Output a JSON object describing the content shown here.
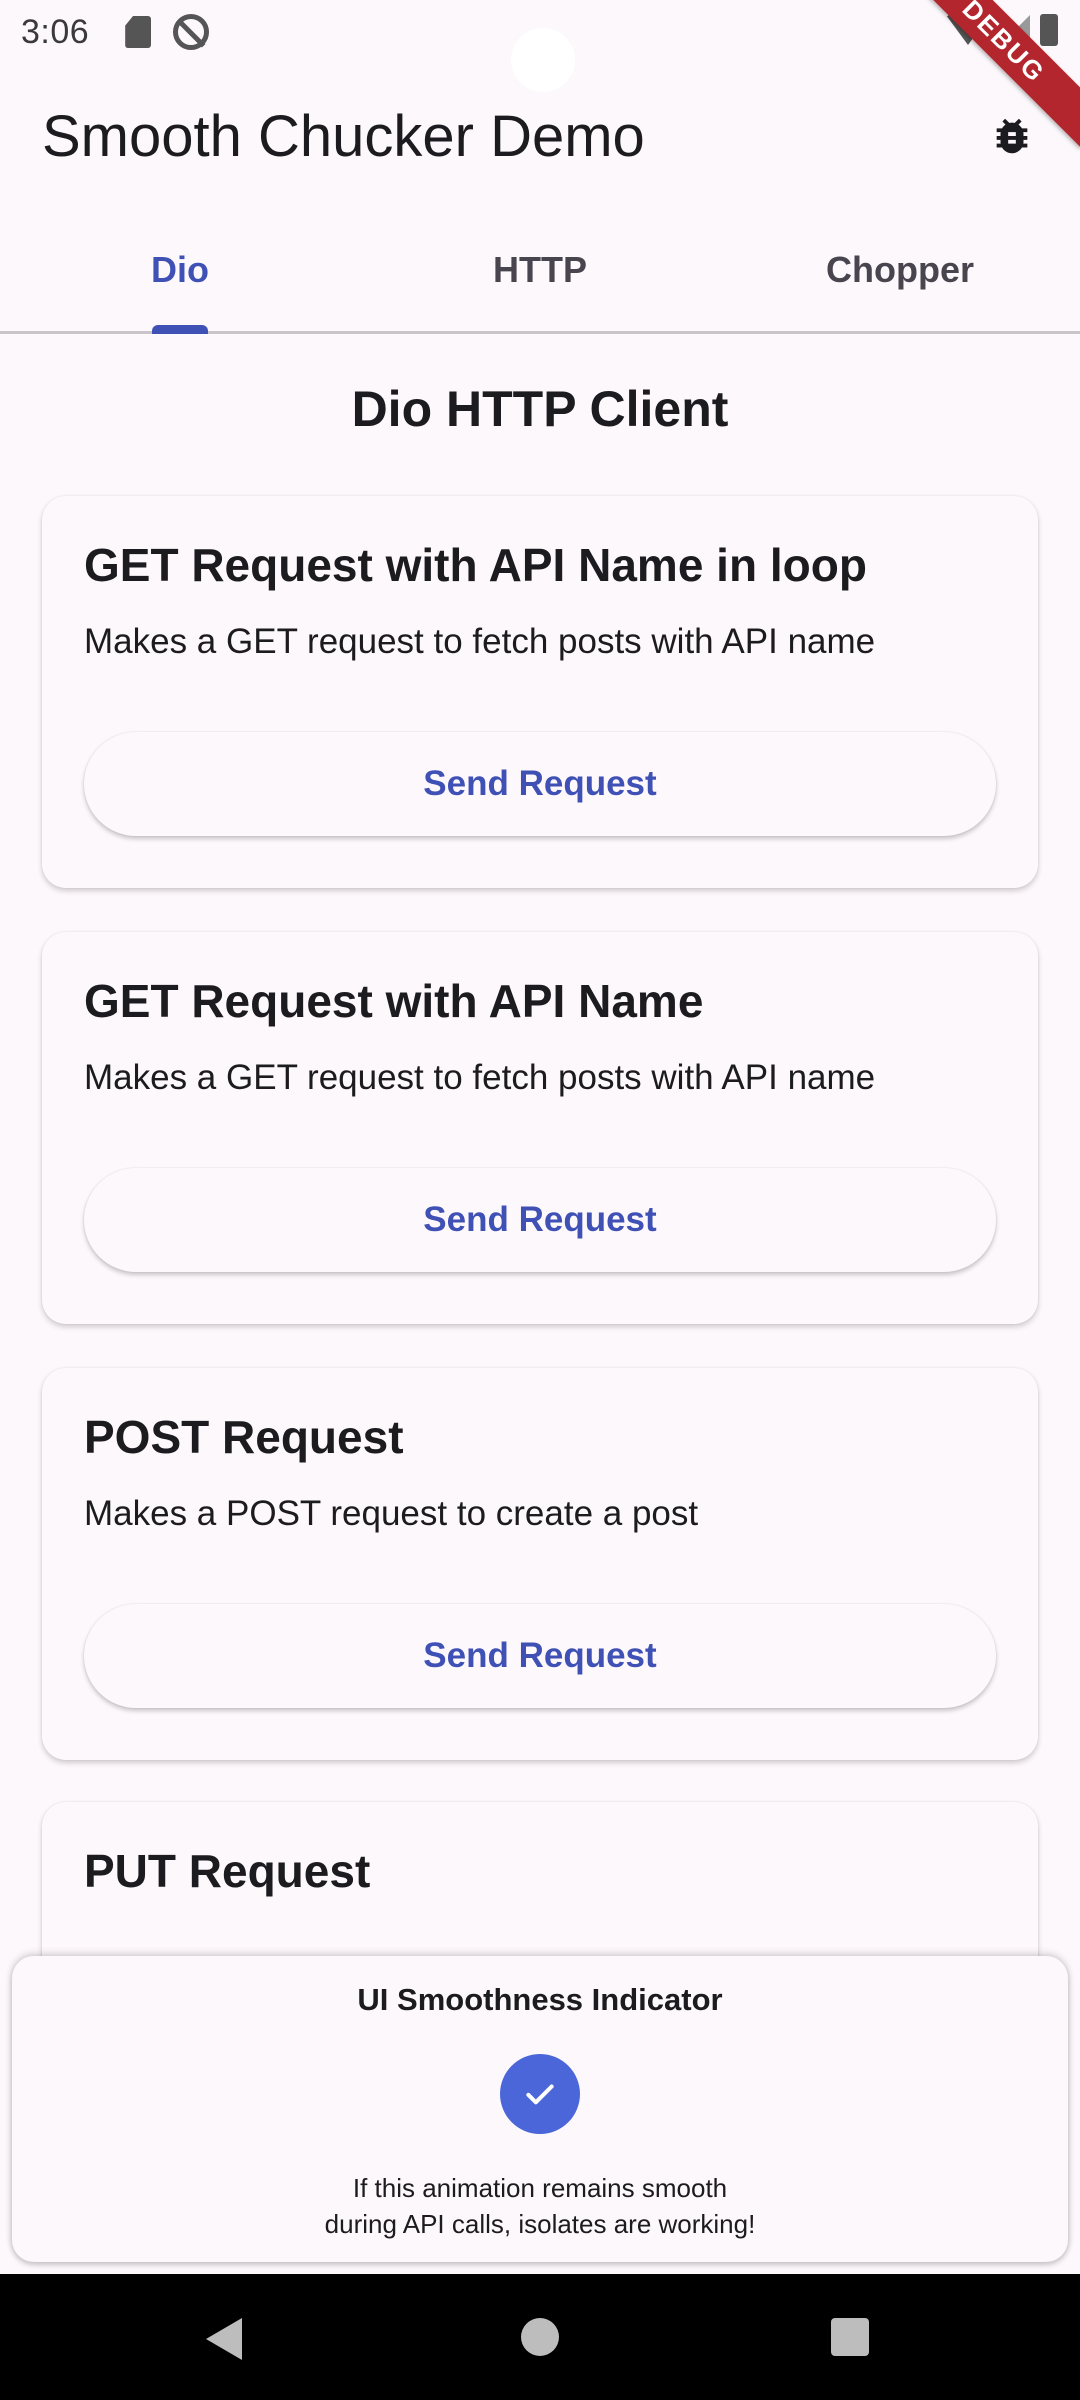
{
  "status_bar": {
    "time": "3:06",
    "debug_banner": "DEBUG"
  },
  "app_bar": {
    "title": "Smooth Chucker Demo",
    "action_icon": "bug-icon"
  },
  "tabs": [
    {
      "label": "Dio",
      "active": true
    },
    {
      "label": "HTTP",
      "active": false
    },
    {
      "label": "Chopper",
      "active": false
    }
  ],
  "page": {
    "heading": "Dio HTTP Client"
  },
  "cards": [
    {
      "title": "GET Request with API Name in loop",
      "description": "Makes a GET request to fetch posts with API name",
      "button": "Send Request"
    },
    {
      "title": "GET Request with API Name",
      "description": "Makes a GET request to fetch posts with API name",
      "button": "Send Request"
    },
    {
      "title": "POST Request",
      "description": "Makes a POST request to create a post",
      "button": "Send Request"
    },
    {
      "title": "PUT Request"
    }
  ],
  "indicator": {
    "title": "UI Smoothness Indicator",
    "icon": "check-icon",
    "text_line1": "If this animation remains smooth",
    "text_line2": "during API calls, isolates are working!"
  },
  "colors": {
    "accent": "#3f51b5",
    "background": "#fdf8fc",
    "indicator_circle": "#4a66d8",
    "debug_banner": "#b3262d"
  }
}
